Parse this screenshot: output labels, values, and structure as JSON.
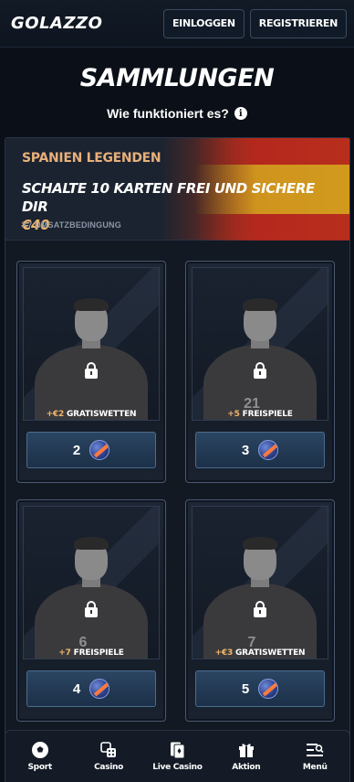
{
  "header": {
    "logo": "GOLAZZO",
    "login_label": "EINLOGGEN",
    "register_label": "REGISTRIEREN"
  },
  "page": {
    "title": "SAMMLUNGEN",
    "how_it_works": "Wie funktioniert es?"
  },
  "banner": {
    "collection_name": "SPANIEN LEGENDEN",
    "headline": "SCHALTE 10 KARTEN FREI UND SICHERE DIR",
    "amount": "€40",
    "wagering": "X7 UMSATZBEDINGUNG"
  },
  "cards": [
    {
      "reward_prefix": "+€2",
      "reward_label": "GRATISWETTEN",
      "count": "2",
      "jersey": ""
    },
    {
      "reward_prefix": "+5",
      "reward_label": "FREISPIELE",
      "count": "3",
      "jersey": "21"
    },
    {
      "reward_prefix": "+7",
      "reward_label": "FREISPIELE",
      "count": "4",
      "jersey": "6"
    },
    {
      "reward_prefix": "+€3",
      "reward_label": "GRATISWETTEN",
      "count": "5",
      "jersey": "7"
    }
  ],
  "bottom_nav": [
    {
      "label": "Sport",
      "icon": "football-icon"
    },
    {
      "label": "Casino",
      "icon": "dice-icon"
    },
    {
      "label": "Live Casino",
      "icon": "cards-icon"
    },
    {
      "label": "Aktion",
      "icon": "gift-icon"
    },
    {
      "label": "Menü",
      "icon": "menu-search-icon"
    }
  ],
  "colors": {
    "background": "#0b1018",
    "accent_gold": "#f2b56c",
    "banner_sub": "#e8b07a",
    "card_box": "#2b4562"
  }
}
